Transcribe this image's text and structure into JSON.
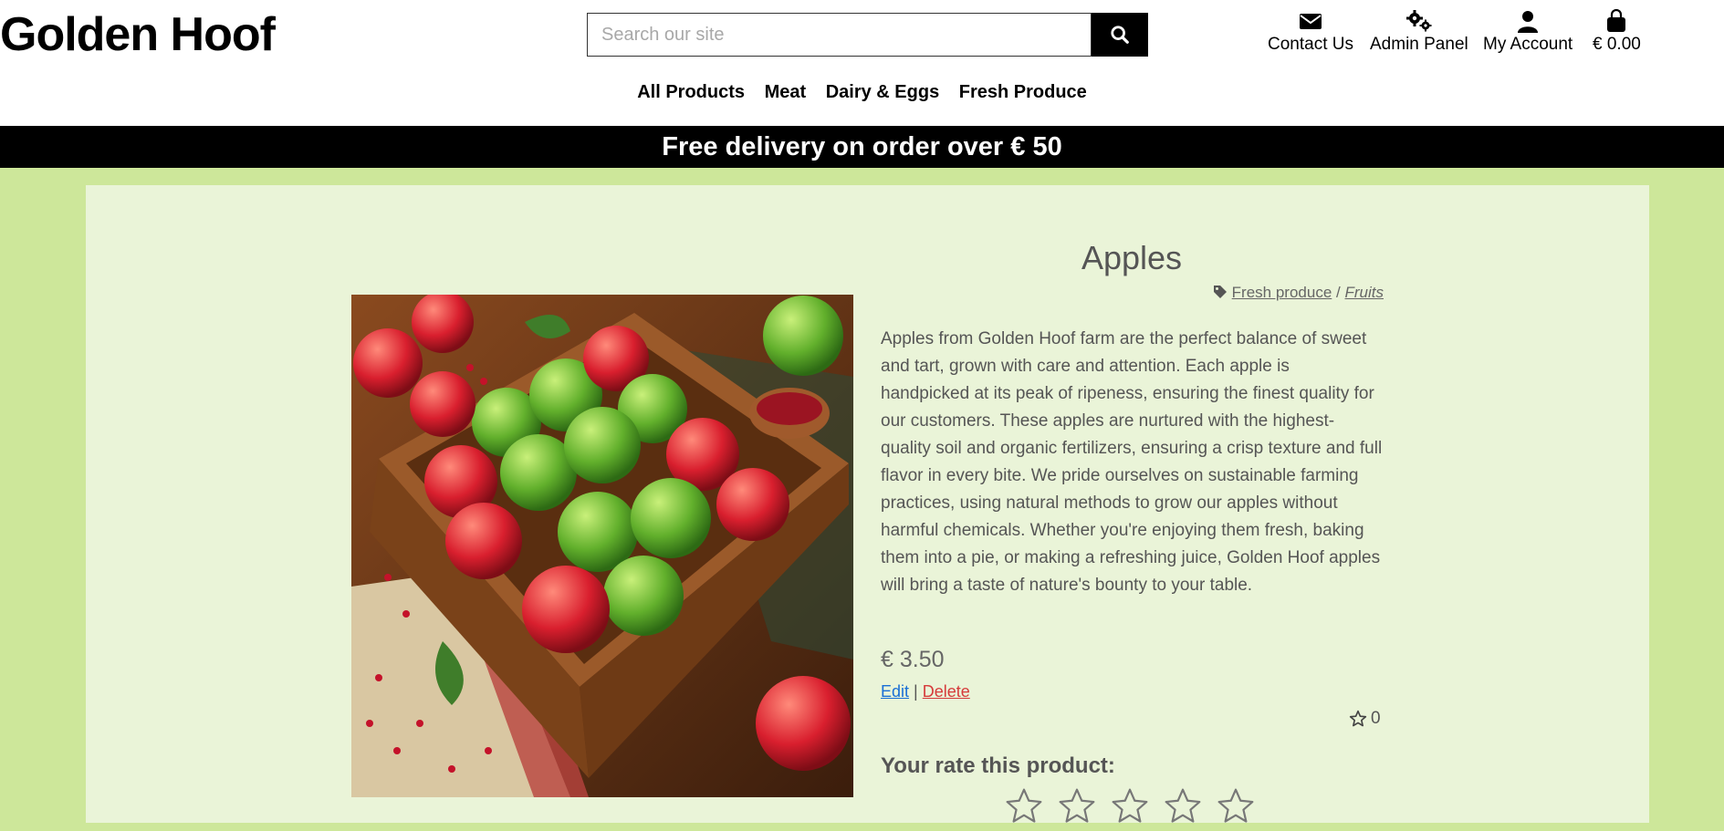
{
  "brand": {
    "name": "Golden Hoof"
  },
  "search": {
    "placeholder": "Search our site"
  },
  "tools": [
    {
      "label": "Contact Us",
      "icon": "envelope-icon"
    },
    {
      "label": "Admin Panel",
      "icon": "gears-icon"
    },
    {
      "label": "My Account",
      "icon": "user-icon"
    },
    {
      "label": "€ 0.00",
      "icon": "shopping-bag-icon"
    }
  ],
  "menu": [
    "All Products",
    "Meat",
    "Dairy & Eggs",
    "Fresh Produce"
  ],
  "banner": {
    "text": "Free delivery on order over € 50"
  },
  "product": {
    "title": "Apples",
    "category": "Fresh produce",
    "separator": "/",
    "subcategory": "Fruits",
    "description": "Apples from Golden Hoof farm are the perfect balance of sweet and tart, grown with care and attention. Each apple is handpicked at its peak of ripeness, ensuring the finest quality for our customers. These apples are nurtured with the highest-quality soil and organic fertilizers, ensuring a crisp texture and full flavor in every bite. We pride ourselves on sustainable farming practices, using natural methods to grow our apples without harmful chemicals. Whether you're enjoying them fresh, baking them into a pie, or making a refreshing juice, Golden Hoof apples will bring a taste of nature's bounty to your table.",
    "price": "€ 3.50",
    "edit_label": "Edit",
    "action_separator": "|",
    "delete_label": "Delete",
    "rating_count": "0",
    "rate_label": "Your rate this product:"
  },
  "colors": {
    "page_bg": "#cde79a",
    "panel_bg": "#eaf4d8",
    "banner_bg": "#000000",
    "edit_link": "#1a6fd6",
    "delete_link": "#d63a3a"
  }
}
